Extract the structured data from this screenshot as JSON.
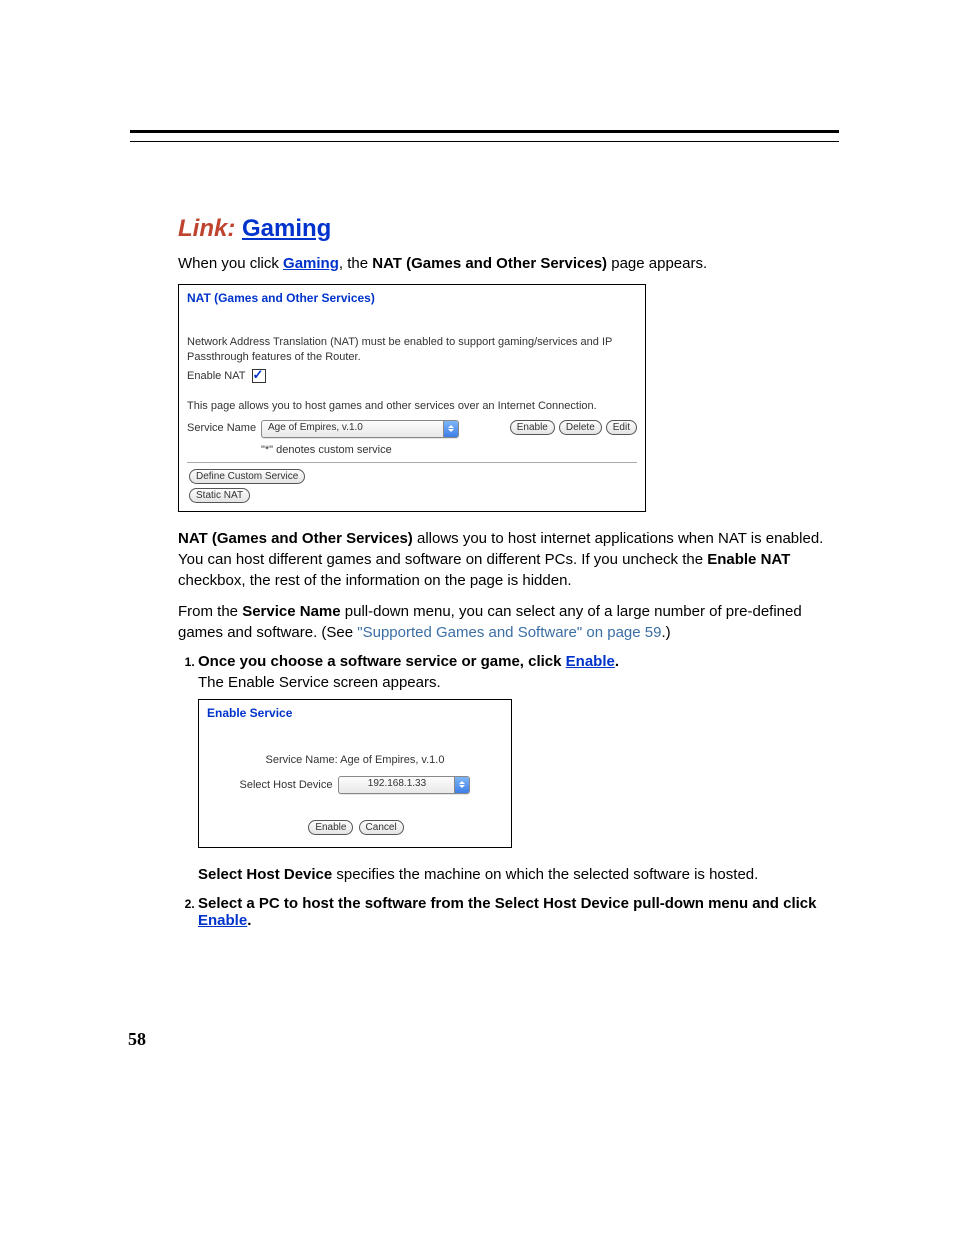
{
  "heading": {
    "prefix": "Link:",
    "title": "Gaming"
  },
  "intro": {
    "before": "When you click ",
    "link": "Gaming",
    "mid": ", the ",
    "bold": "NAT (Games and Other Services)",
    "after": " page appears."
  },
  "panel1": {
    "title": "NAT (Games and Other Services)",
    "desc": "Network Address Translation (NAT) must be enabled to support gaming/services and IP Passthrough features of the Router.",
    "enable_label": "Enable NAT",
    "desc2": "This page allows you to host games and other services over an Internet Connection.",
    "service_label": "Service Name",
    "dropdown_value": "Age of Empires, v.1.0",
    "btn_enable": "Enable",
    "btn_delete": "Delete",
    "btn_edit": "Edit",
    "custom_note": "\"*\" denotes custom service",
    "btn_define": "Define Custom Service",
    "btn_static": "Static NAT"
  },
  "para2": {
    "bold1": "NAT (Games and Other Services)",
    "text1": " allows you to host internet applications when NAT is enabled. You can host different games and software on different PCs. If you uncheck the ",
    "bold2": "Enable NAT",
    "text2": " checkbox, the rest of the information on the page is hidden."
  },
  "para3": {
    "before": "From the ",
    "bold": "Service Name",
    "mid": " pull-down menu, you can select any of a large number of pre-defined games and software. (See ",
    "ref": "\"Supported Games and Software\" on page 59",
    "after": ".)"
  },
  "step1": {
    "head_before": "Once you choose a software service or game, click ",
    "head_link": "Enable",
    "head_after": ".",
    "sub": "The Enable Service screen appears."
  },
  "panel2": {
    "title": "Enable Service",
    "service_name_label": "Service Name: Age of Empires, v.1.0",
    "host_label": "Select Host Device",
    "dropdown_value": "192.168.1.33",
    "btn_enable": "Enable",
    "btn_cancel": "Cancel"
  },
  "para4": {
    "bold": "Select Host Device",
    "text": " specifies the machine on which the selected software is hosted."
  },
  "step2": {
    "before": "Select a PC to host the software from the Select Host Device pull-down menu and click ",
    "link": "Enable",
    "after": "."
  },
  "page_number": "58"
}
